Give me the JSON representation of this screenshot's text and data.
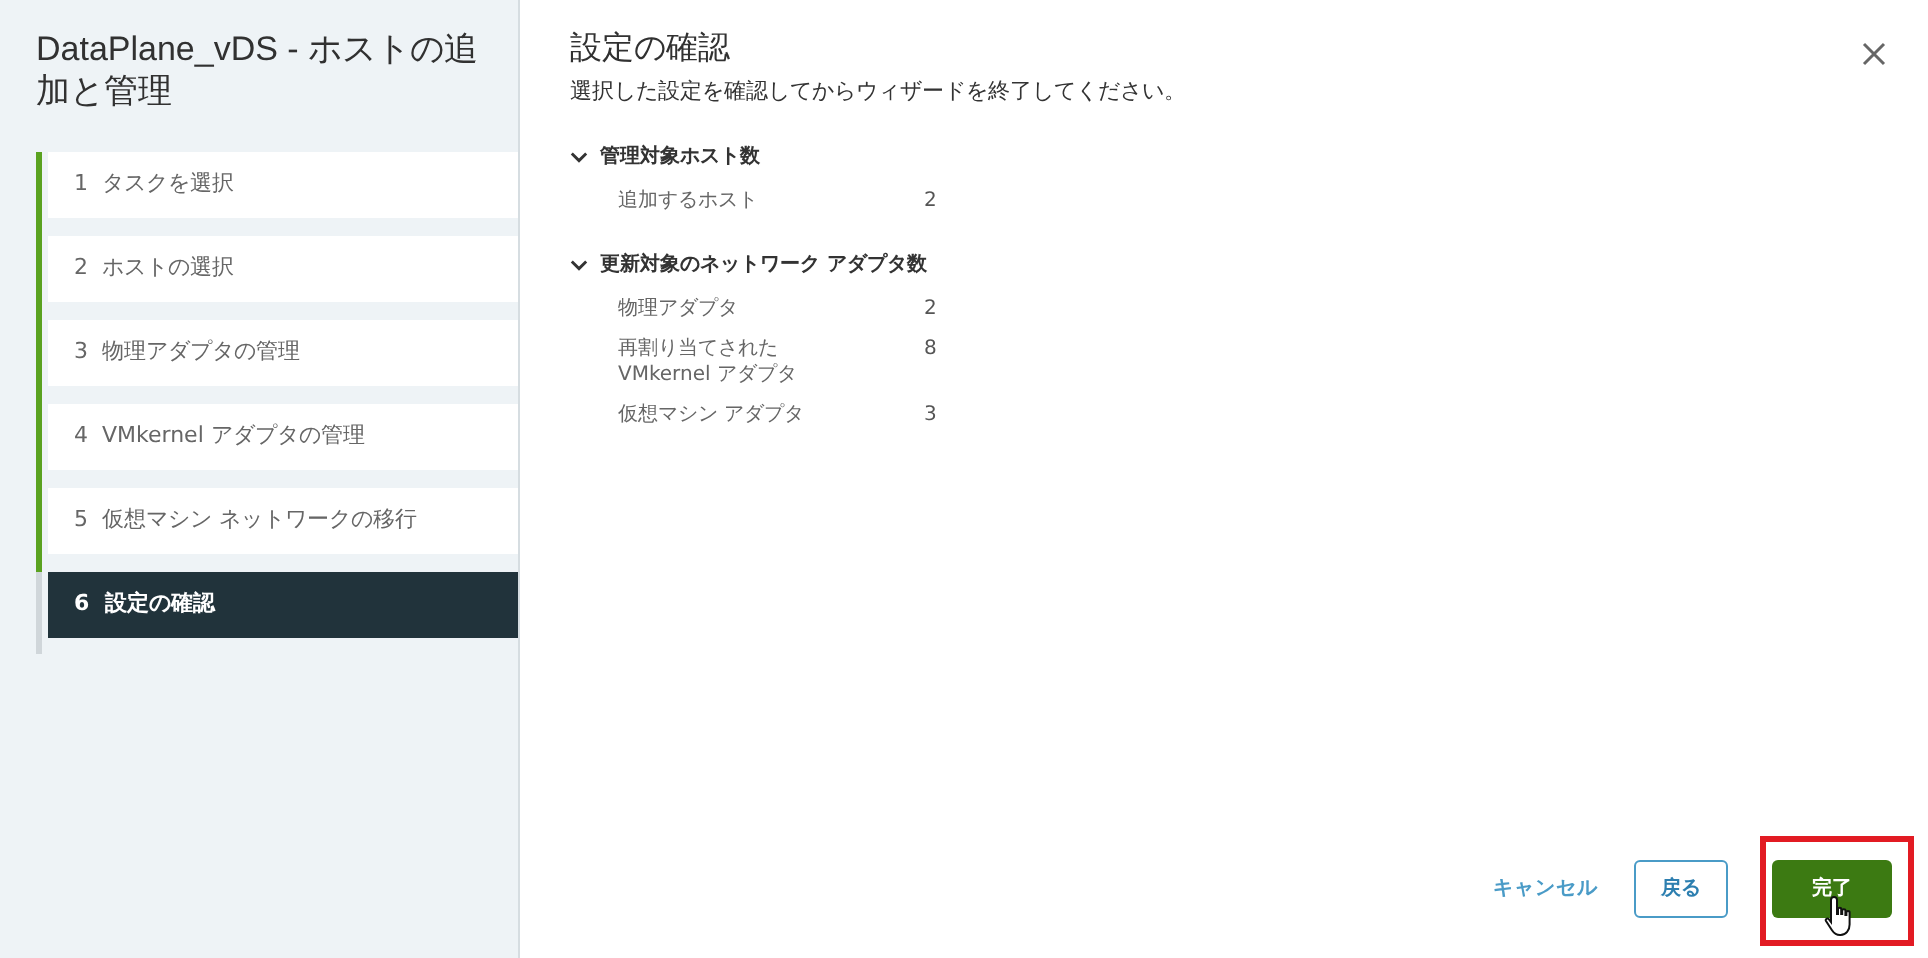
{
  "wizard": {
    "title": "DataPlane_vDS - ホストの追加と管理",
    "steps": [
      {
        "label": "1  タスクを選択",
        "selected": false,
        "completed": true
      },
      {
        "label": "2  ホストの選択",
        "selected": false,
        "completed": true
      },
      {
        "label": "3  物理アダプタの管理",
        "selected": false,
        "completed": true
      },
      {
        "label": "4  VMkernel アダプタの管理",
        "selected": false,
        "completed": true
      },
      {
        "label": "5  仮想マシン ネットワークの移行",
        "selected": false,
        "completed": true
      },
      {
        "label": "6  設定の確認",
        "selected": true,
        "completed": false
      }
    ]
  },
  "page": {
    "title": "設定の確認",
    "description": "選択した設定を確認してからウィザードを終了してください。",
    "sections": [
      {
        "title": "管理対象ホスト数",
        "expanded": true,
        "rows": [
          {
            "label": "追加するホスト",
            "value": "2"
          }
        ]
      },
      {
        "title": "更新対象のネットワーク アダプタ数",
        "expanded": true,
        "rows": [
          {
            "label": "物理アダプタ",
            "value": "2"
          },
          {
            "label": "再割り当てされた\nVMkernel アダプタ",
            "value": "8"
          },
          {
            "label": "仮想マシン アダプタ",
            "value": "3"
          }
        ]
      }
    ]
  },
  "buttons": {
    "cancel": "キャンセル",
    "back": "戻る",
    "finish": "完了"
  }
}
